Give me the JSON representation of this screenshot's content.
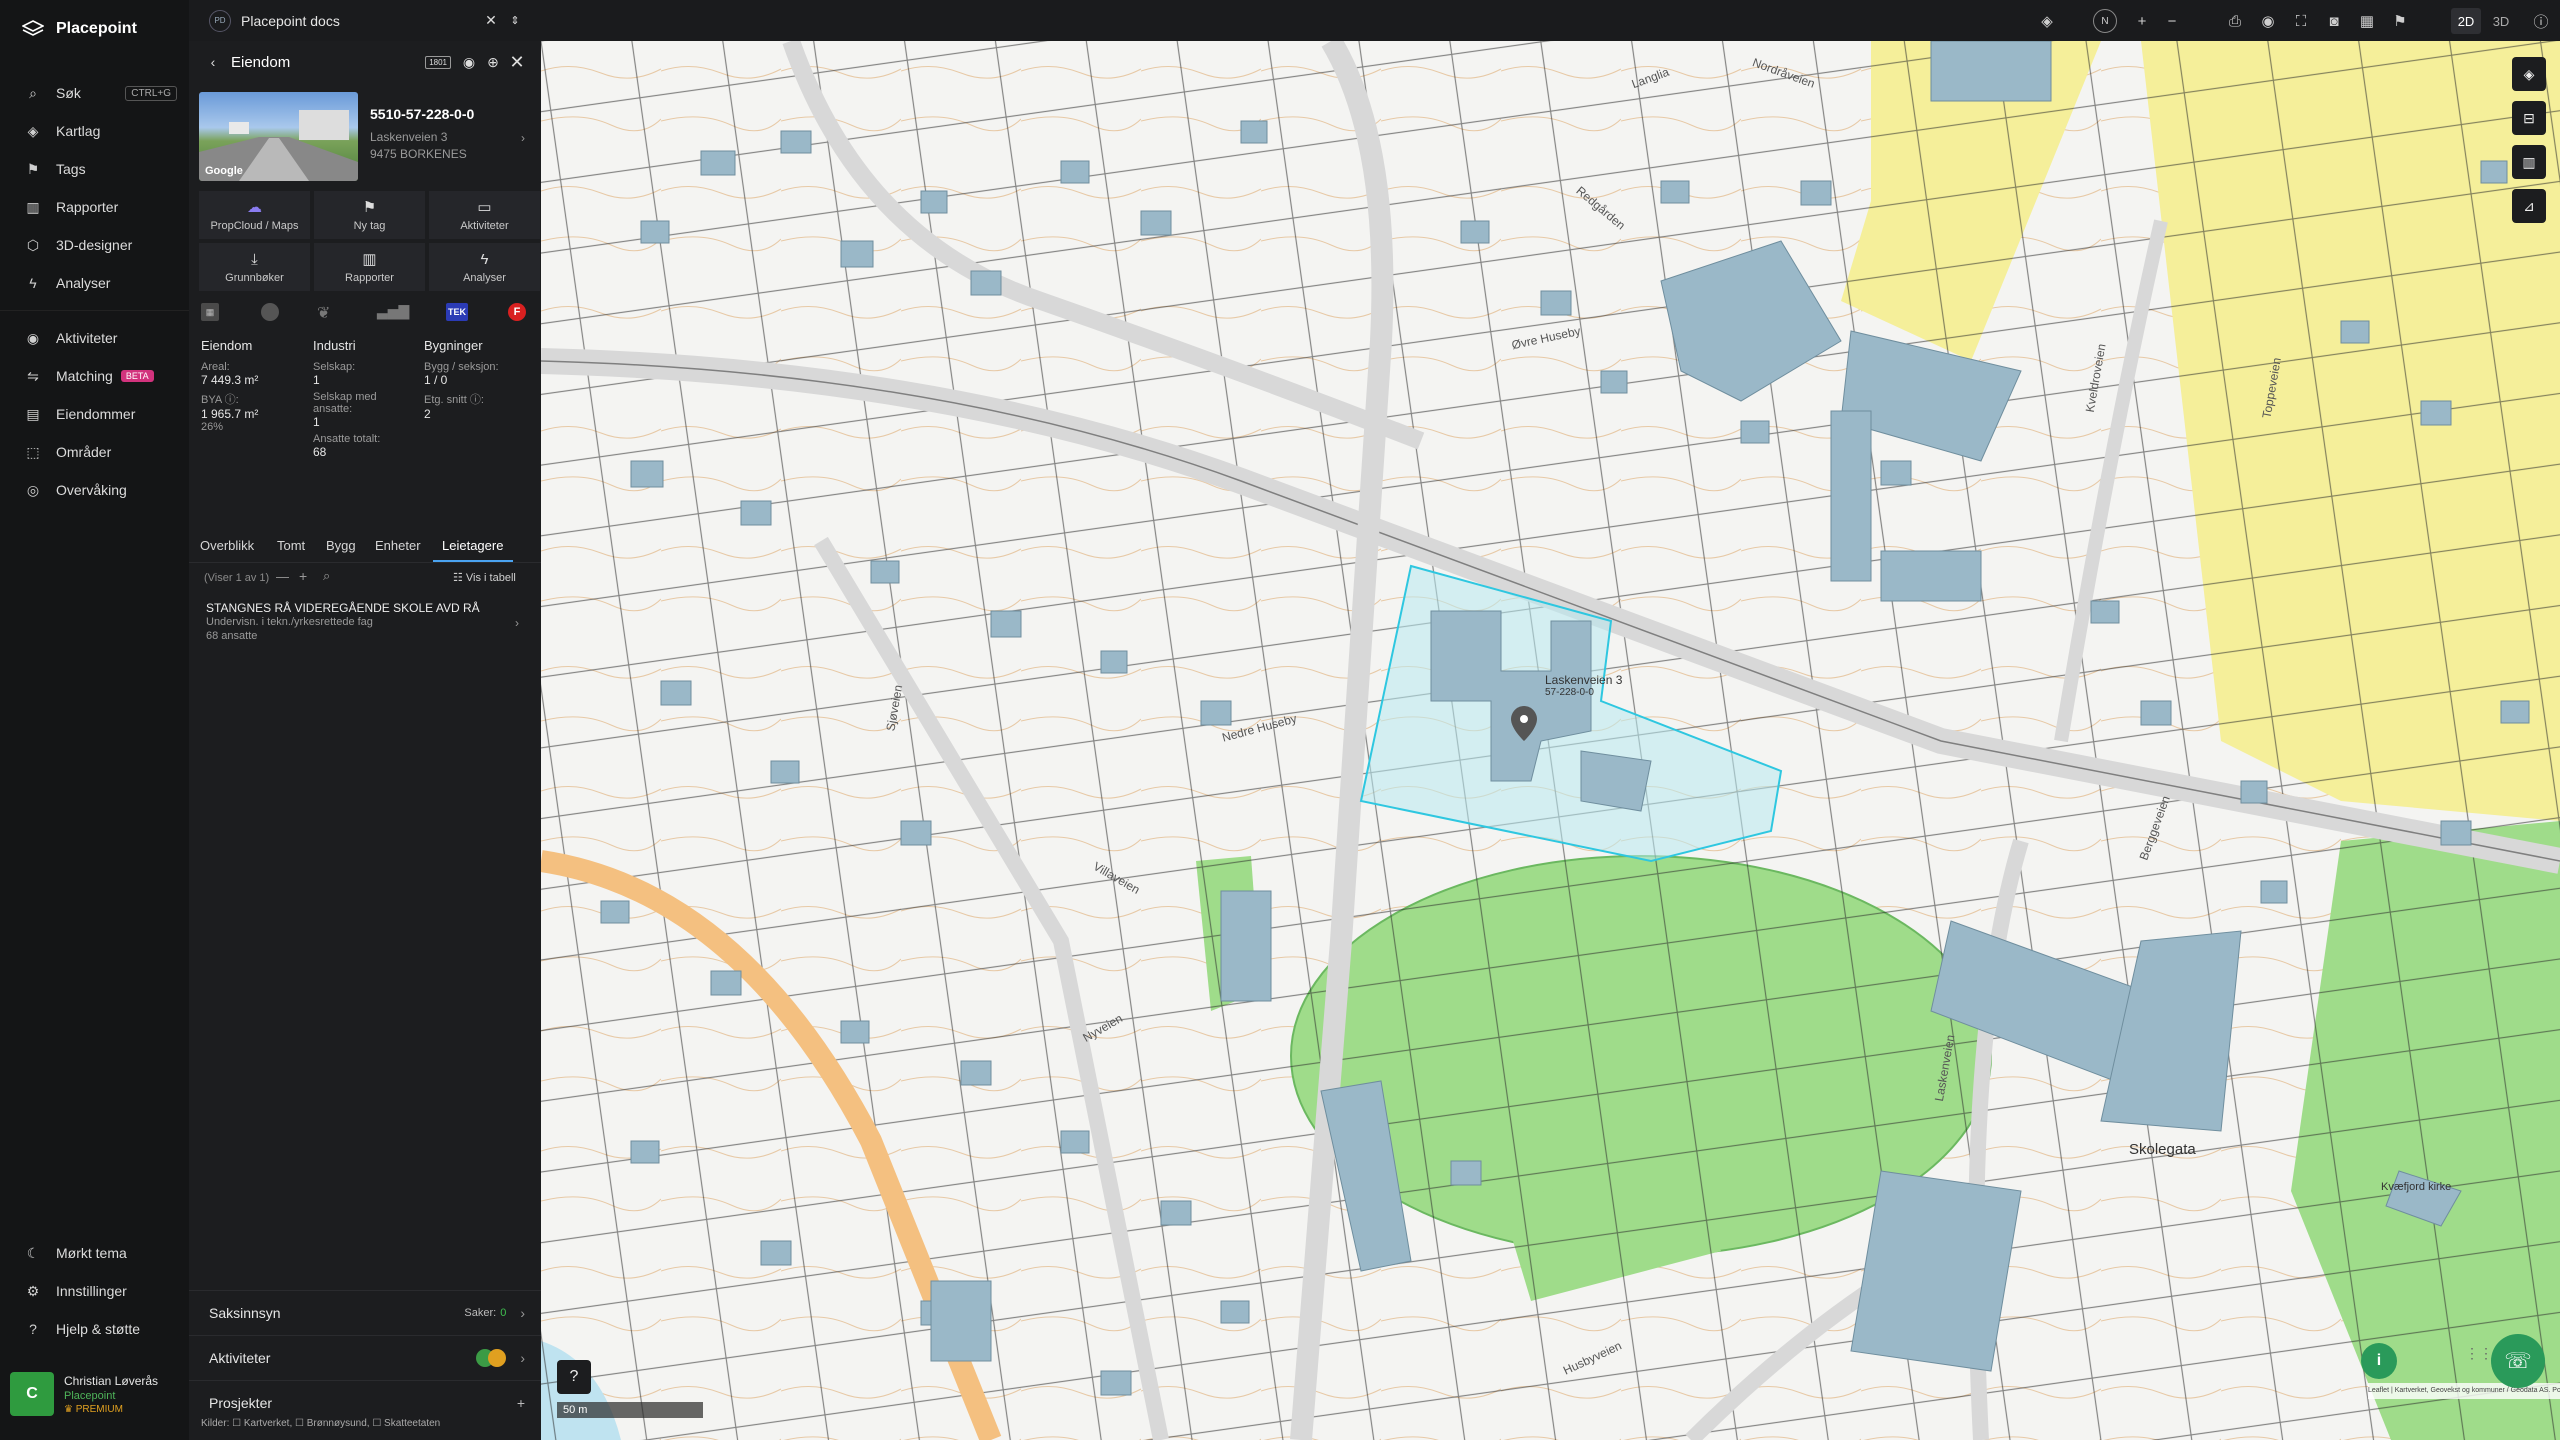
{
  "app": {
    "brand": "Placepoint"
  },
  "nav": {
    "items": [
      {
        "label": "Søk",
        "shortcut": "CTRL+G"
      },
      {
        "label": "Kartlag"
      },
      {
        "label": "Tags"
      },
      {
        "label": "Rapporter"
      },
      {
        "label": "3D-designer"
      },
      {
        "label": "Analyser"
      }
    ],
    "items2": [
      {
        "label": "Aktiviteter"
      },
      {
        "label": "Matching",
        "badge": "BETA"
      },
      {
        "label": "Eiendommer"
      },
      {
        "label": "Områder"
      },
      {
        "label": "Overvåking"
      }
    ],
    "bottom": [
      {
        "label": "Mørkt tema"
      },
      {
        "label": "Innstillinger"
      },
      {
        "label": "Hjelp & støtte"
      }
    ],
    "user": {
      "initial": "C",
      "name": "Christian Løverås",
      "org": "Placepoint",
      "plan": "PREMIUM"
    }
  },
  "docs": {
    "badge": "PD",
    "title": "Placepoint docs"
  },
  "panel": {
    "title": "Eiendom",
    "id_badge": "1801",
    "property": {
      "id": "5510-57-228-0-0",
      "address": "Laskenveien 3",
      "postal": "9475 BORKENES",
      "photo_credit": "Google"
    },
    "actions": [
      {
        "label": "PropCloud / Maps"
      },
      {
        "label": "Ny tag"
      },
      {
        "label": "Aktiviteter"
      },
      {
        "label": "Grunnbøker"
      },
      {
        "label": "Rapporter"
      },
      {
        "label": "Analyser"
      }
    ],
    "sources": {
      "tek": "TEK",
      "f": "F"
    },
    "stats": {
      "eiendom": {
        "heading": "Eiendom",
        "areal_label": "Areal:",
        "areal": "7 449.3 m²",
        "bya_label": "BYA ⓘ:",
        "bya": "1 965.7 m²",
        "bya_pct": "26%"
      },
      "industri": {
        "heading": "Industri",
        "selskap_label": "Selskap:",
        "selskap": "1",
        "ansatte_label": "Selskap med ansatte:",
        "ansatte": "1",
        "totalt_label": "Ansatte totalt:",
        "totalt": "68"
      },
      "bygninger": {
        "heading": "Bygninger",
        "bygg_label": "Bygg / seksjon:",
        "bygg": "1 / 0",
        "etg_label": "Etg. snitt ⓘ:",
        "etg": "2"
      }
    },
    "tabs": [
      "Overblikk",
      "Tomt",
      "Bygg",
      "Enheter",
      "Leietagere"
    ],
    "list": {
      "count": "(Viser 1 av 1)",
      "table_link": "Vis i tabell"
    },
    "tenant": {
      "name": "STANGNES RÅ VIDEREGÅENDE SKOLE AVD RÅ",
      "sector": "Undervisn. i tekn./yrkesrettede fag",
      "employees": "68 ansatte"
    },
    "sections": {
      "saksinnsyn": "Saksinnsyn",
      "saker_label": "Saker:",
      "saker": "0",
      "aktiviteter": "Aktiviteter",
      "prosjekter": "Prosjekter"
    },
    "sources_footer": "Kilder: ☐ Kartverket, ☐ Brønnøysund, ☐ Skatteetaten"
  },
  "toolbar": {
    "mode2d": "2D",
    "mode3d": "3D"
  },
  "map": {
    "marker_label": "Laskenveien 3",
    "marker_id": "57-228-0-0",
    "streets": [
      "Langlia",
      "Nordråveien",
      "Redgården",
      "Øvre Huseby",
      "Nedre Huseby",
      "Kveldroveien",
      "Toppeveien",
      "Villaveien",
      "Skolegata",
      "Laskenveien",
      "Berggeveien",
      "Husbyveien",
      "Kvæfjord kirke",
      "Sjøveien",
      "Nyveien"
    ],
    "scale": "50 m",
    "attribution": "Leaflet | Kartverket, Geovekst og kommuner / Geodata AS. Powered by Esri",
    "colors": {
      "parcel_fill": "#f4f4f2",
      "building": "#9ab8c8",
      "selected": "#2ec7e0",
      "green": "#9fdc8a",
      "yellow": "#f5ef9a",
      "water": "#bfe3f0"
    }
  }
}
